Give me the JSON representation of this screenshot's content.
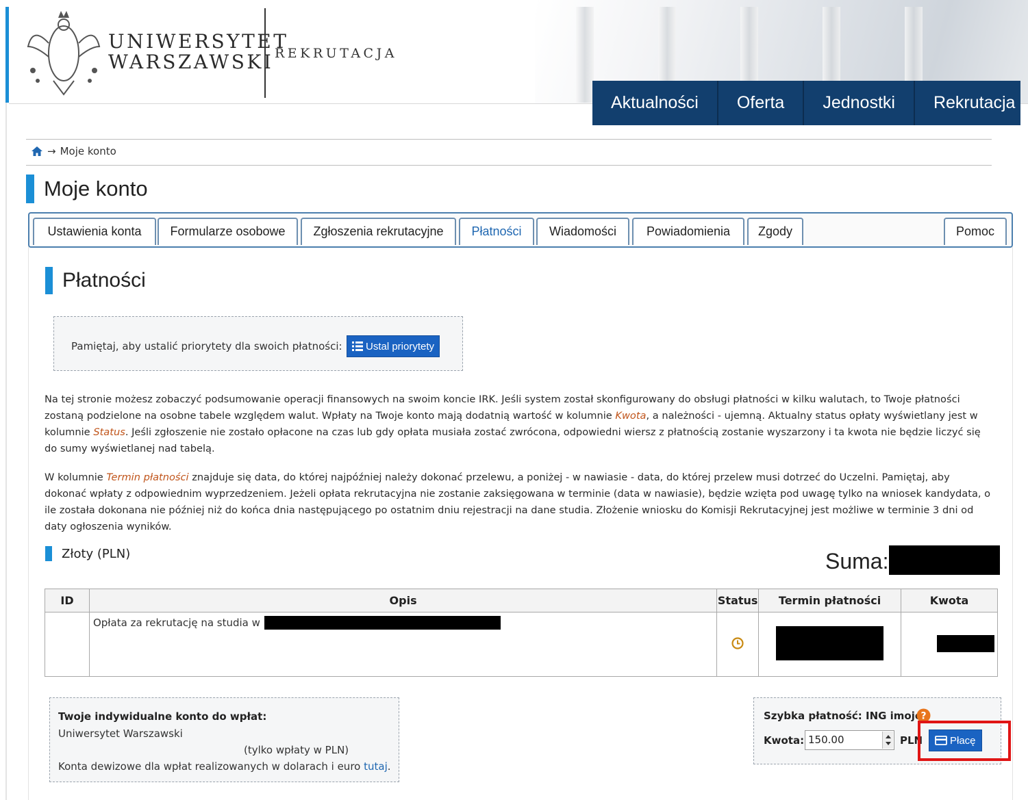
{
  "header": {
    "logo_line1": "UNIWERSYTET",
    "logo_line2": "WARSZAWSKI",
    "logo_sub": "REKRUTACJA",
    "nav": [
      "Aktualności",
      "Oferta",
      "Jednostki",
      "Rekrutacja"
    ]
  },
  "breadcrumb": {
    "arrow": "→",
    "current": "Moje konto"
  },
  "page_title": "Moje konto",
  "tabs": {
    "items": [
      "Ustawienia konta",
      "Formularze osobowe",
      "Zgłoszenia rekrutacyjne",
      "Płatności",
      "Wiadomości",
      "Powiadomienia",
      "Zgody"
    ],
    "help": "Pomoc",
    "active": "Płatności"
  },
  "section_title": "Płatności",
  "priority": {
    "text": "Pamiętaj, aby ustalić priorytety dla swoich płatności:",
    "button": "Ustal priorytety"
  },
  "info": {
    "p1_a": "Na tej stronie możesz zobaczyć podsumowanie operacji finansowych na swoim koncie IRK. Jeśli system został skonfigurowany do obsługi płatności w kilku walutach, to Twoje płatności zostaną podzielone na osobne tabele względem walut. Wpłaty na Twoje konto mają dodatnią wartość w kolumnie ",
    "p1_kwota": "Kwota",
    "p1_b": ", a należności - ujemną. Aktualny status opłaty wyświetlany jest w kolumnie ",
    "p1_status": "Status",
    "p1_c": ". Jeśli zgłoszenie nie zostało opłacone na czas lub gdy opłata musiała zostać zwrócona, odpowiedni wiersz z płatnością zostanie wyszarzony i ta kwota nie będzie liczyć się do sumy wyświetlanej nad tabelą.",
    "p2_a": "W kolumnie ",
    "p2_termin": "Termin płatności",
    "p2_b": " znajduje się data, do której najpóźniej należy dokonać przelewu, a poniżej - w nawiasie - data, do której przelew musi dotrzeć do Uczelni. Pamiętaj, aby dokonać wpłaty z odpowiednim wyprzedzeniem. Jeżeli opłata rekrutacyjna nie zostanie zaksięgowana w terminie (data w nawiasie), będzie wzięta pod uwagę tylko na wniosek kandydata, o ile została dokonana nie później niż do końca dnia następującego po ostatnim dniu rejestracji na dane studia. Złożenie wniosku do Komisji Rekrutacyjnej jest możliwe w terminie 3 dni od daty ogłoszenia wyników."
  },
  "currency_label": "Złoty (PLN)",
  "suma_label": "Suma:",
  "table": {
    "headers": [
      "ID",
      "Opis",
      "Status",
      "Termin płatności",
      "Kwota"
    ],
    "rows": [
      {
        "id": "",
        "opis": "Opłata za rekrutację na studia w \""
      }
    ]
  },
  "account": {
    "title": "Twoje indywidualne konto do wpłat:",
    "bank_name": "Uniwersytet Warszawski",
    "pln_only": "(tylko wpłaty w PLN)",
    "foreign_text": "Konta dewizowe dla wpłat realizowanych w dolarach i euro ",
    "foreign_link": "tutaj",
    "foreign_end": "."
  },
  "quick_pay": {
    "title": "Szybka płatność: ING imoje",
    "amount_label": "Kwota:",
    "amount_value": "150.00",
    "currency": "PLN",
    "button": "Płacę"
  },
  "colors": {
    "accent": "#1b8fd6",
    "nav_bg": "#123f6e",
    "button_blue": "#1a63c2",
    "italic_highlight": "#c0541a",
    "annotation_red": "#e01515"
  },
  "icons": [
    "home-icon",
    "list-icon",
    "clock-icon",
    "help-icon",
    "card-icon"
  ]
}
